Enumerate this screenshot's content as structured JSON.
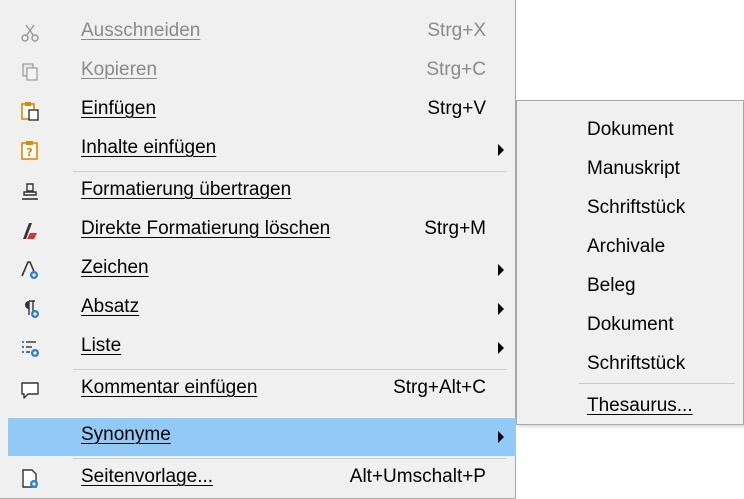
{
  "menu": {
    "items": [
      {
        "label": "Ausschneiden",
        "shortcut": "Strg+X",
        "icon": "scissors-icon",
        "disabled": true
      },
      {
        "label": "Kopieren",
        "shortcut": "Strg+C",
        "icon": "copy-icon",
        "disabled": true
      },
      {
        "label": "Einfügen",
        "shortcut": "Strg+V",
        "icon": "paste-icon",
        "disabled": false
      },
      {
        "label": "Inhalte einfügen",
        "shortcut": "",
        "icon": "paste-special-icon",
        "submenu": true
      },
      {
        "label": "Formatierung übertragen",
        "shortcut": "",
        "icon": "clone-formatting-icon"
      },
      {
        "label": "Direkte Formatierung löschen",
        "shortcut": "Strg+M",
        "icon": "clear-formatting-icon"
      },
      {
        "label": "Zeichen",
        "shortcut": "",
        "icon": "character-icon",
        "submenu": true
      },
      {
        "label": "Absatz",
        "shortcut": "",
        "icon": "paragraph-icon",
        "submenu": true
      },
      {
        "label": "Liste",
        "shortcut": "",
        "icon": "list-icon",
        "submenu": true
      },
      {
        "label": "Kommentar einfügen",
        "shortcut": "Strg+Alt+C",
        "icon": "comment-icon"
      },
      {
        "label": "Synonyme",
        "shortcut": "",
        "icon": "",
        "submenu": true,
        "highlighted": true
      },
      {
        "label": "Seitenvorlage...",
        "shortcut": "Alt+Umschalt+P",
        "icon": "page-style-icon"
      }
    ]
  },
  "submenu": {
    "items": [
      "Dokument",
      "Manuskript",
      "Schriftstück",
      "Archivale",
      "Beleg",
      "Dokument",
      "Schriftstück"
    ],
    "thesaurus": "Thesaurus..."
  },
  "colors": {
    "menu_bg": "#f0f0f0",
    "highlight": "#91c9f7",
    "disabled_text": "#8a8a8a",
    "icon_orange": "#d98a00",
    "icon_blue": "#2f7fd0"
  }
}
